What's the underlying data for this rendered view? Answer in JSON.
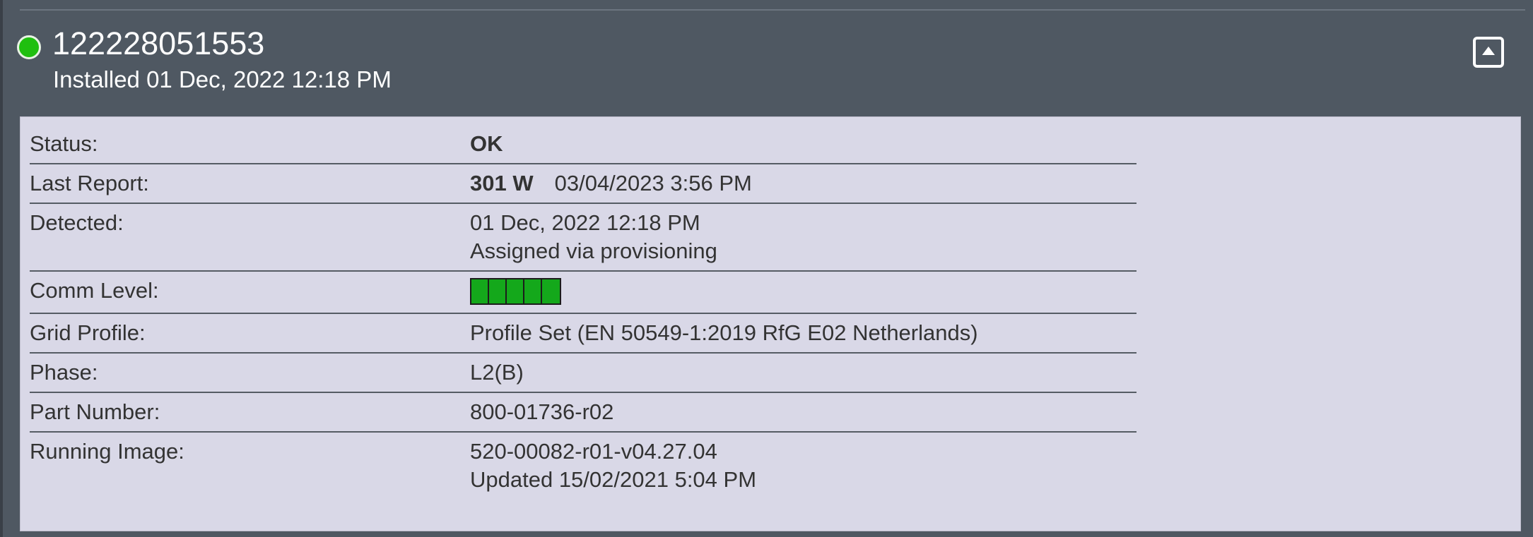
{
  "device": {
    "status_color": "#1fbf0f",
    "serial": "122228051553",
    "installed": "Installed 01 Dec, 2022 12:18 PM",
    "collapse_icon": "collapse-up-icon"
  },
  "details": {
    "status": {
      "label": "Status:",
      "value": "OK"
    },
    "last_report": {
      "label": "Last Report:",
      "power": "301 W",
      "timestamp": "03/04/2023 3:56 PM"
    },
    "detected": {
      "label": "Detected:",
      "date": "01 Dec, 2022 12:18 PM",
      "note": "Assigned via provisioning"
    },
    "comm_level": {
      "label": "Comm Level:",
      "bars_filled": 5,
      "bars_total": 5,
      "color": "#14a81b"
    },
    "grid_profile": {
      "label": "Grid Profile:",
      "value": "Profile Set (EN 50549-1:2019 RfG E02 Netherlands)"
    },
    "phase": {
      "label": "Phase:",
      "value": "L2(B)"
    },
    "part_number": {
      "label": "Part Number:",
      "value": "800-01736-r02"
    },
    "running_image": {
      "label": "Running Image:",
      "value": "520-00082-r01-v04.27.04",
      "updated": "Updated 15/02/2021 5:04 PM"
    }
  }
}
